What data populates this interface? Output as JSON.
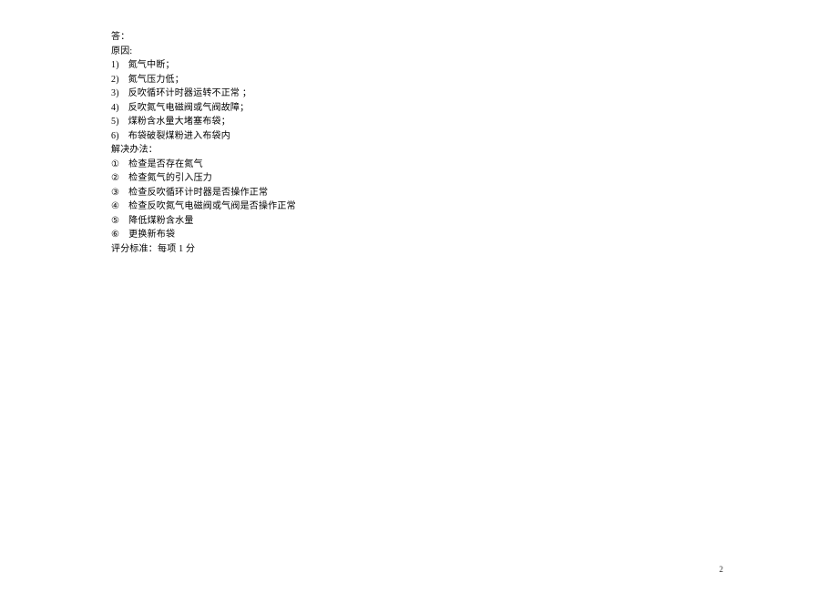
{
  "header": {
    "answer_label": "答：",
    "reason_label": "原因:"
  },
  "reasons": [
    {
      "num": "1)",
      "text": "氮气中断；"
    },
    {
      "num": "2)",
      "text": "氮气压力低；"
    },
    {
      "num": "3)",
      "text": "反吹循环计时器运转不正常 ；"
    },
    {
      "num": "4)",
      "text": "反吹氮气电磁阀或气阀故障；"
    },
    {
      "num": "5)",
      "text": "煤粉含水量大堵塞布袋；"
    },
    {
      "num": "6)",
      "text": "布袋破裂煤粉进入布袋内"
    }
  ],
  "solution_label": "解决办法：",
  "solutions": [
    {
      "num": "①",
      "text": "检查是否存在氮气"
    },
    {
      "num": "②",
      "text": "检查氮气的引入压力"
    },
    {
      "num": "③",
      "text": "检查反吹循环计时器是否操作正常"
    },
    {
      "num": "④",
      "text": "检查反吹氮气电磁阀或气阀是否操作正常"
    },
    {
      "num": "⑤",
      "text": "降低煤粉含水量"
    },
    {
      "num": "⑥",
      "text": "更换新布袋"
    }
  ],
  "scoring": "评分标准：每项 1 分",
  "page_number": "2"
}
